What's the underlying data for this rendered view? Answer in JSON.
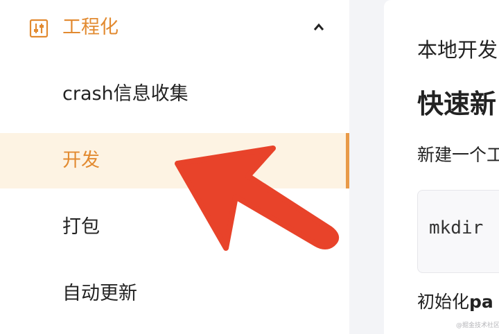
{
  "sidebar": {
    "group": {
      "title": "工程化",
      "icon": "sliders-icon",
      "caret_icon": "chevron-up-icon",
      "accent_color": "#e28a30"
    },
    "items": [
      {
        "label": "crash信息收集",
        "active": false
      },
      {
        "label": "开发",
        "active": true
      },
      {
        "label": "打包",
        "active": false
      },
      {
        "label": "自动更新",
        "active": false
      }
    ],
    "active_bg_color": "#fdf3e3",
    "active_bar_color": "#e99a48"
  },
  "content": {
    "subtitle": "本地开发",
    "heading": "快速新",
    "line": "新建一个工",
    "code": "mkdir",
    "init_prefix": "初始化",
    "init_bold": "pa"
  },
  "watermark": "@掘金技术社区",
  "annotation": {
    "type": "arrow",
    "color": "#e8432a"
  }
}
